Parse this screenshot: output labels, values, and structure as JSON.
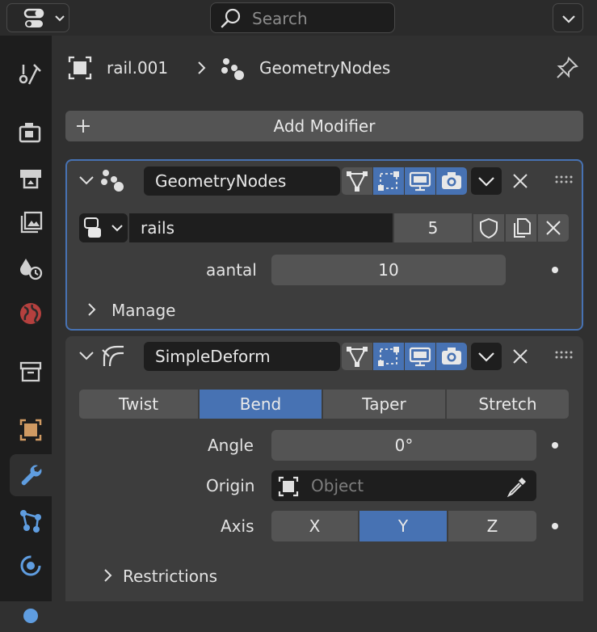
{
  "search": {
    "placeholder": "Search"
  },
  "breadcrumb": {
    "object": "rail.001",
    "modifier": "GeometryNodes"
  },
  "add_modifier": {
    "label": "Add Modifier"
  },
  "geometry_nodes": {
    "name": "GeometryNodes",
    "nodegroup_name": "rails",
    "users": "5",
    "aantal_label": "aantal",
    "aantal_value": "10",
    "manage_label": "Manage"
  },
  "simple_deform": {
    "name": "SimpleDeform",
    "modes": [
      "Twist",
      "Bend",
      "Taper",
      "Stretch"
    ],
    "active_mode": "Bend",
    "angle_label": "Angle",
    "angle_value": "0°",
    "origin_label": "Origin",
    "origin_placeholder": "Object",
    "axis_label": "Axis",
    "axes": [
      "X",
      "Y",
      "Z"
    ],
    "active_axis": "Y",
    "restrictions_label": "Restrictions"
  },
  "colors": {
    "accent": "#4772b3",
    "background": "#303030",
    "tabbar": "#1d1d1d",
    "panel": "#3d3d3d",
    "field": "#545454"
  }
}
